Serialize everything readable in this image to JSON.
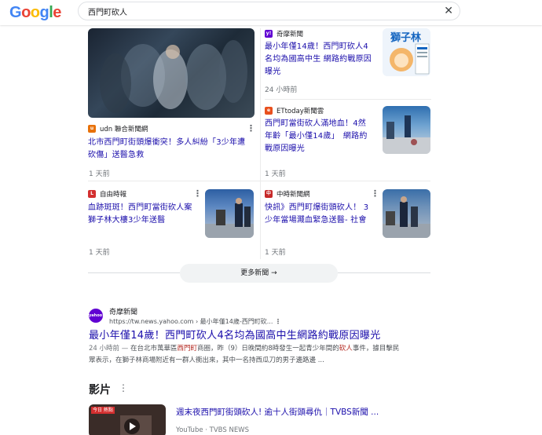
{
  "google_logo": [
    "G",
    "o",
    "o",
    "g",
    "l",
    "e"
  ],
  "search": {
    "query": "西門町砍人",
    "clear_label": "✕"
  },
  "news_cards": [
    {
      "source": "udn 聯合新聞網",
      "title_line1": "北市西門町街頭爆衝突！多人糾紛「3少年遭",
      "title_line2": "砍傷」送醫急救",
      "time": "1 天前"
    },
    {
      "source": "奇摩新聞",
      "title_line1": "最小年僅14歲！西門町砍人4",
      "title_line2": "名均為國高中生 網路約戰原因",
      "title_line3": "曝光",
      "time": "24 小時前",
      "thumb_text": "獅子林"
    },
    {
      "source": "ETtoday新聞雲",
      "title_line1": "西門町當街砍人滿地血！4然",
      "title_line2": "年齡「最小僅14歲」　網路約",
      "title_line3": "戰原因曝光",
      "time": "1 天前"
    },
    {
      "source": "自由時報",
      "title_line1": "血跡斑斑！西門町當街砍人案",
      "title_line2": "獅子林大樓3少年送醫",
      "time": "1 天前"
    },
    {
      "source": "中時新聞網",
      "title_line1": "快訊》西門町爆街頭砍人！ 3",
      "title_line2": "少年當場濺血緊急送醫- 社會",
      "time": "1 天前"
    }
  ],
  "more_news": {
    "label": "更多新聞",
    "arrow": "→"
  },
  "result": {
    "icon_text": "yahoo!",
    "site": "奇摩新聞",
    "url": "https://tw.news.yahoo.com › 最小年僅14歲-西門町砍...",
    "title": "最小年僅14歲！西門町砍人4名均為國高中生網路約戰原因曝光",
    "snippet_time": "24 小時前 — ",
    "snippet_a": "在台北市萬華區",
    "snippet_hl1": "西門町",
    "snippet_b": "商圈，昨（9）日晚間約8時發生一起青少年間的",
    "snippet_hl2": "砍人",
    "snippet_c": "事件，據目擊民",
    "snippet_line2": "眾表示，在獅子林商場附近有一群人衝出來，其中一名持西瓜刀的男子邊路邊 ..."
  },
  "videos": {
    "heading": "影片",
    "more": "⋮",
    "title": "週末夜西門町街頭砍人! 逾十人街頭尋仇｜TVBS新聞 ...",
    "sub": "YouTube · TVBS NEWS",
    "thumb_badge": "今日 熱點"
  },
  "colors": {
    "link": "#1a0dab",
    "meta": "#70757a",
    "yahoo": "#6001d2"
  }
}
